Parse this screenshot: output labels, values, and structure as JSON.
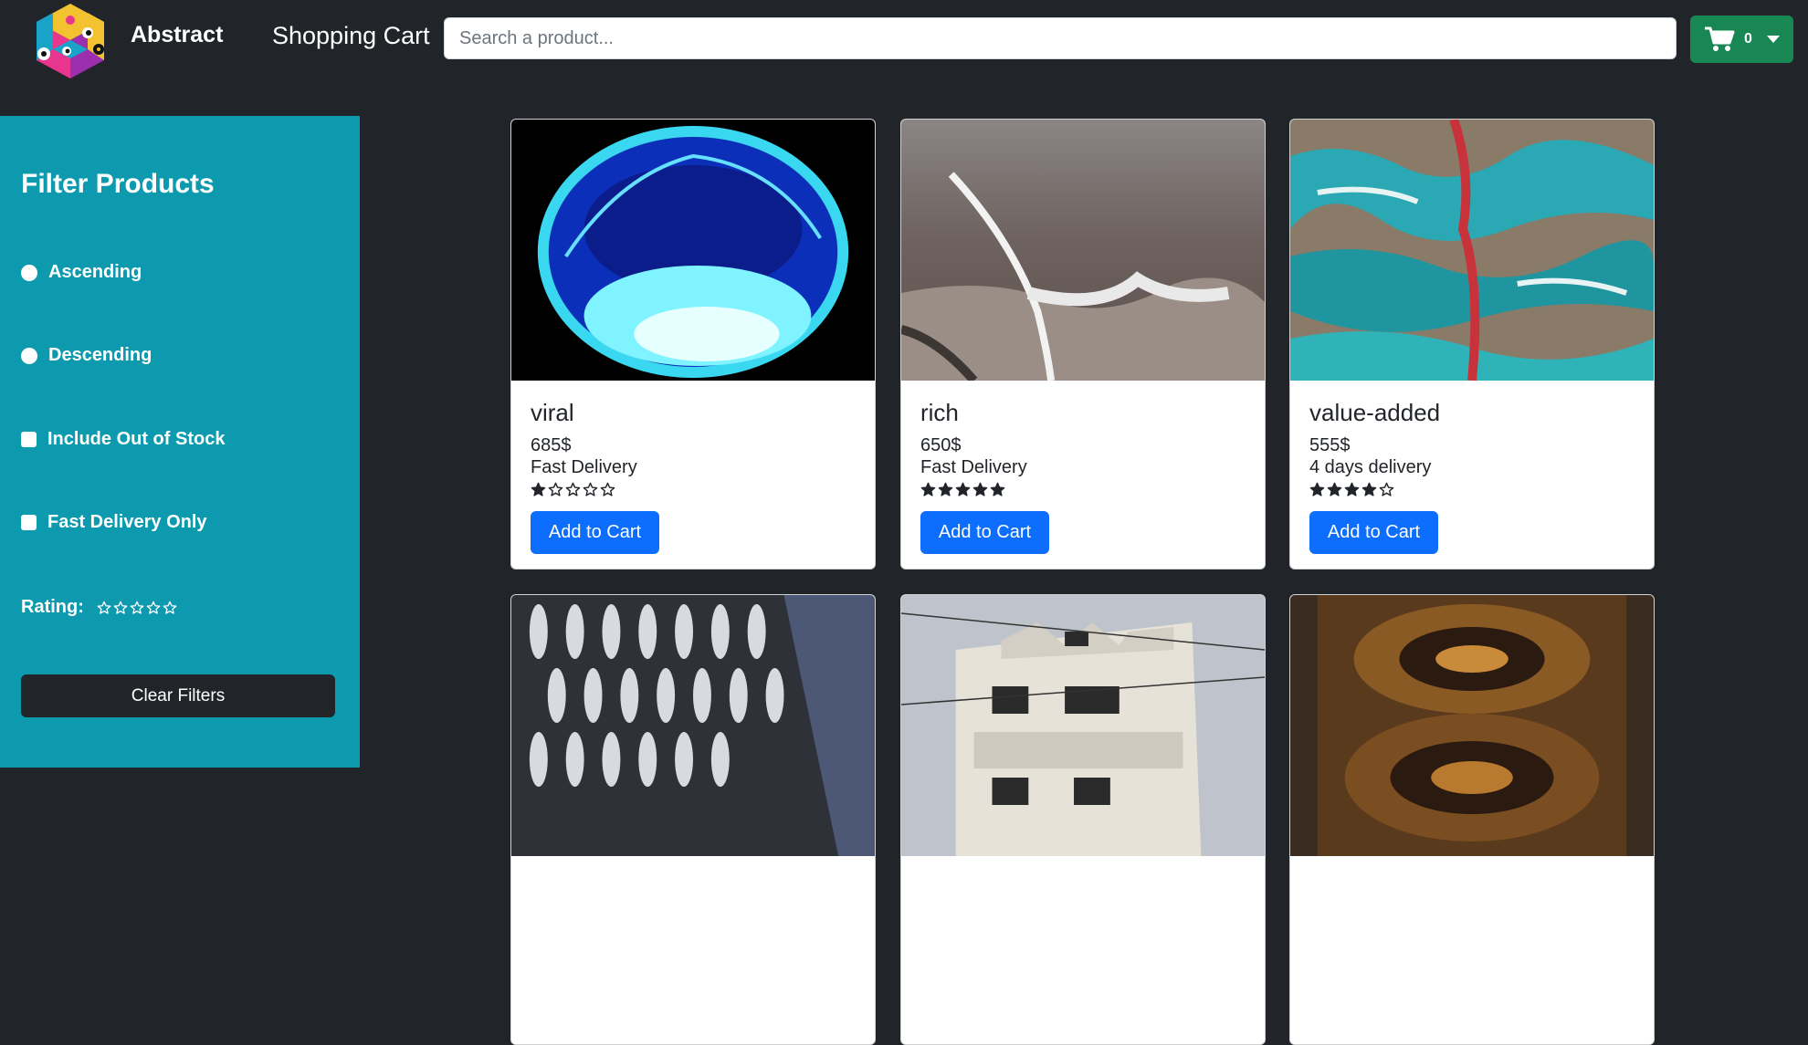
{
  "navbar": {
    "brand": "Abstract",
    "title": "Shopping Cart",
    "search_placeholder": "Search a product...",
    "cart_count": "0"
  },
  "sidebar": {
    "title": "Filter Products",
    "ascending_label": "Ascending",
    "descending_label": "Descending",
    "out_of_stock_label": "Include Out of Stock",
    "fast_delivery_label": "Fast Delivery Only",
    "rating_label": "Rating:",
    "rating_value": 0,
    "clear_label": "Clear Filters"
  },
  "products": [
    {
      "name": "viral",
      "price": "685$",
      "delivery": "Fast Delivery",
      "rating": 1,
      "button": "Add to Cart"
    },
    {
      "name": "rich",
      "price": "650$",
      "delivery": "Fast Delivery",
      "rating": 5,
      "button": "Add to Cart"
    },
    {
      "name": "value-added",
      "price": "555$",
      "delivery": "4 days delivery",
      "rating": 4,
      "button": "Add to Cart"
    },
    {
      "name": "",
      "price": "",
      "delivery": "",
      "rating": 0,
      "button": ""
    },
    {
      "name": "",
      "price": "",
      "delivery": "",
      "rating": 0,
      "button": ""
    },
    {
      "name": "",
      "price": "",
      "delivery": "",
      "rating": 0,
      "button": ""
    }
  ],
  "colors": {
    "page_bg": "#212529",
    "sidebar_bg": "#0d9aaf",
    "cart_button": "#198754",
    "add_button": "#0d6efd"
  }
}
